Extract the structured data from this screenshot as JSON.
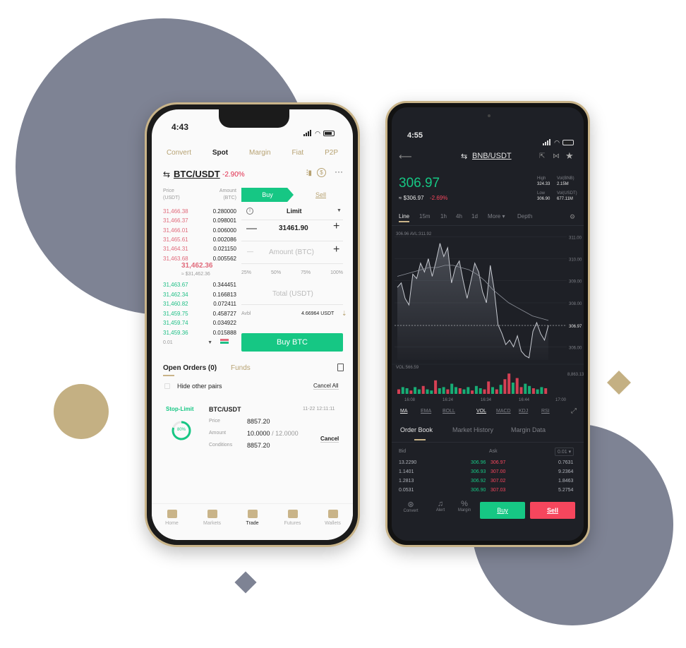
{
  "decor": {
    "circle_color": "#7e8394",
    "gold_color": "#c4b083",
    "diamond_dark": "#7e8394"
  },
  "light_phone": {
    "status_time": "4:43",
    "tabs": [
      "Convert",
      "Spot",
      "Margin",
      "Fiat",
      "P2P"
    ],
    "active_tab": "Spot",
    "pair": "BTC/USDT",
    "change": "-2.90%",
    "orderbook_header": {
      "price": "Price\n(USDT)",
      "amount": "Amount\n(BTC)",
      "price_line1": "Price",
      "price_line2": "(USDT)",
      "amount_line1": "Amount",
      "amount_line2": "(BTC)"
    },
    "asks": [
      {
        "price": "31,466.38",
        "amount": "0.280000"
      },
      {
        "price": "31,466.37",
        "amount": "0.098001"
      },
      {
        "price": "31,466.01",
        "amount": "0.006000"
      },
      {
        "price": "31,465.61",
        "amount": "0.002086"
      },
      {
        "price": "31,464.31",
        "amount": "0.021150"
      },
      {
        "price": "31,463.68",
        "amount": "0.005562"
      }
    ],
    "last_price": "31,462.36",
    "last_price_usd": "≈ $31,462.36",
    "bids": [
      {
        "price": "31,463.67",
        "amount": "0.344451"
      },
      {
        "price": "31,462.34",
        "amount": "0.166813"
      },
      {
        "price": "31,460.82",
        "amount": "0.072411"
      },
      {
        "price": "31,459.75",
        "amount": "0.458727"
      },
      {
        "price": "31,459.74",
        "amount": "0.034922"
      },
      {
        "price": "31,459.36",
        "amount": "0.015888"
      }
    ],
    "depth_select": "0.01",
    "buy_tab": "Buy",
    "sell_tab": "Sell",
    "order_type": "Limit",
    "price_value": "31461.90",
    "amount_placeholder": "Amount (BTC)",
    "percents": [
      "25%",
      "50%",
      "75%",
      "100%"
    ],
    "total_placeholder": "Total (USDT)",
    "avbl_label": "Avbl",
    "avbl_value": "4.66964 USDT",
    "buy_button": "Buy BTC",
    "open_orders_label": "Open Orders (0)",
    "funds_label": "Funds",
    "hide_pairs_label": "Hide other pairs",
    "cancel_all": "Cancel All",
    "order": {
      "type": "Stop-Limit",
      "pair": "BTC/USDT",
      "date": "11-22 12:11:11",
      "progress": "80%",
      "progress_value": 0.8,
      "price_label": "Price",
      "price": "8857.20",
      "amount_label": "Amount",
      "amount_filled": "10.0000",
      "amount_total": "/ 12.0000",
      "conditions_label": "Conditions",
      "conditions": "8857.20",
      "cancel": "Cancel"
    },
    "nav": [
      "Home",
      "Markets",
      "Trade",
      "Futures",
      "Wallets"
    ],
    "nav_active": "Trade"
  },
  "dark_phone": {
    "status_time": "4:55",
    "pair": "BNB/USDT",
    "price": "306.97",
    "price_usd": "≈ $306.97",
    "change": "-2.69%",
    "stats": [
      {
        "label": "High",
        "value": "324.33",
        "label2": "Vol(BNB)",
        "value2": "2.15M"
      },
      {
        "label": "Low",
        "value": "306.90",
        "label2": "Vol(USDT)",
        "value2": "677.11M"
      }
    ],
    "intervals": [
      "Line",
      "15m",
      "1h",
      "4h",
      "1d",
      "More ▾",
      "Depth"
    ],
    "active_interval": "Line",
    "chart_legend": "306.96 AVL:311.92",
    "price_axis": [
      "311.00",
      "310.00",
      "309.00",
      "308.00",
      "306.97",
      "306.00"
    ],
    "time_axis": [
      "16:08",
      "16:24",
      "16:34",
      "16:44",
      "17:00"
    ],
    "vol_label": "VOL:566.59",
    "vol_axis": "8,863.13",
    "indicators": [
      "MA",
      "EMA",
      "BOLL",
      "VOL",
      "MACD",
      "KDJ",
      "RSI"
    ],
    "book_tabs": [
      "Order Book",
      "Market History",
      "Margin Data"
    ],
    "active_book_tab": "Order Book",
    "book_header": {
      "bid": "Bid",
      "ask": "Ask",
      "depth": "0.01 ▾"
    },
    "book_rows": [
      {
        "bid_amt": "13.2290",
        "bid": "306.96",
        "ask": "306.97",
        "ask_amt": "0.7631"
      },
      {
        "bid_amt": "1.1401",
        "bid": "306.93",
        "ask": "307.00",
        "ask_amt": "9.2364"
      },
      {
        "bid_amt": "1.2813",
        "bid": "306.92",
        "ask": "307.02",
        "ask_amt": "1.8463"
      },
      {
        "bid_amt": "0.0531",
        "bid": "306.90",
        "ask": "307.03",
        "ask_amt": "5.2754"
      }
    ],
    "bottom_icons": [
      "Convert",
      "Alert",
      "Margin"
    ],
    "buy": "Buy",
    "sell": "Sell",
    "green": "#16c784",
    "red": "#f6465d"
  }
}
